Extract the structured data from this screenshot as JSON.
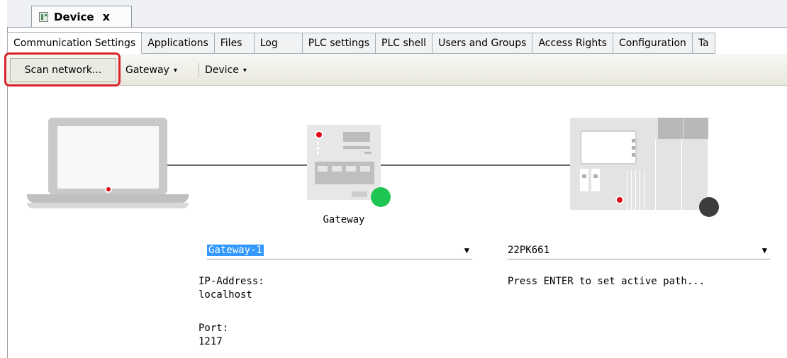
{
  "document_tab": {
    "title": "Device",
    "close": "x",
    "icon": "device-icon"
  },
  "tabs": [
    {
      "label": "Communication Settings",
      "active": true
    },
    {
      "label": "Applications",
      "active": false
    },
    {
      "label": "Files",
      "active": false
    },
    {
      "label": "Log",
      "active": false
    },
    {
      "label": "PLC settings",
      "active": false
    },
    {
      "label": "PLC shell",
      "active": false
    },
    {
      "label": "Users and Groups",
      "active": false
    },
    {
      "label": "Access Rights",
      "active": false
    },
    {
      "label": "Configuration",
      "active": false
    },
    {
      "label": "Ta",
      "active": false
    }
  ],
  "toolbar": {
    "scan_label": "Scan network...",
    "gateway_label": "Gateway",
    "device_label": "Device",
    "dropdown_caret": "▾"
  },
  "diagram": {
    "gateway_label": "Gateway",
    "gateway_status_color": "#1ec552",
    "device_status_color": "#3c3c3c",
    "accent_red": "#e30613"
  },
  "gateway_panel": {
    "selected": "Gateway-1",
    "ip_label": "IP-Address:",
    "ip_value": "localhost",
    "port_label": "Port:",
    "port_value": "1217"
  },
  "device_panel": {
    "selected": "22PK661",
    "hint": "Press ENTER to set active path..."
  },
  "highlight_color": "#d9232a"
}
